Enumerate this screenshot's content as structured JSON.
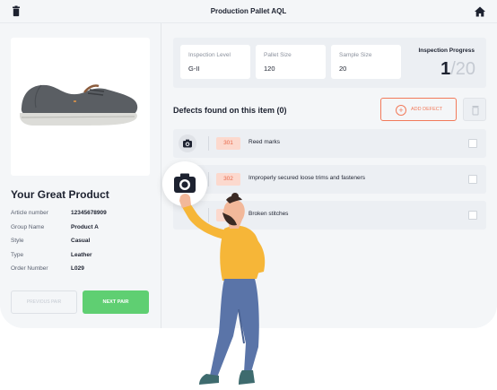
{
  "header": {
    "title": "Production Pallet AQL",
    "left_icon": "trash-icon",
    "right_icon": "home-icon"
  },
  "product": {
    "title": "Your Great Product",
    "specs": [
      {
        "label": "Article number",
        "value": "12345678909"
      },
      {
        "label": "Group Name",
        "value": "Product A"
      },
      {
        "label": "Style",
        "value": "Casual"
      },
      {
        "label": "Type",
        "value": "Leather"
      },
      {
        "label": "Order Number",
        "value": "L029"
      }
    ],
    "prev_label": "PREVIOUS PAIR",
    "next_label": "NEXT PAIR"
  },
  "inspection": {
    "level_label": "Inspection Level",
    "level_value": "G-II",
    "pallet_label": "Pallet Size",
    "pallet_value": "120",
    "sample_label": "Sample Size",
    "sample_value": "20",
    "progress_label": "Inspection Progress",
    "progress_done": "1",
    "progress_sep": "/",
    "progress_total": "20"
  },
  "defects": {
    "title": "Defects found on this item (0)",
    "add_label": "ADD DEFECT",
    "items": [
      {
        "code": "301",
        "label": "Reed marks"
      },
      {
        "code": "302",
        "label": "Improperly secured loose trims and fasteners"
      },
      {
        "code": "303",
        "label": "Broken stitches"
      }
    ]
  },
  "colors": {
    "accent_green": "#5fcf72",
    "accent_orange": "#f27a5a",
    "badge_bg": "#fcd9ce"
  }
}
